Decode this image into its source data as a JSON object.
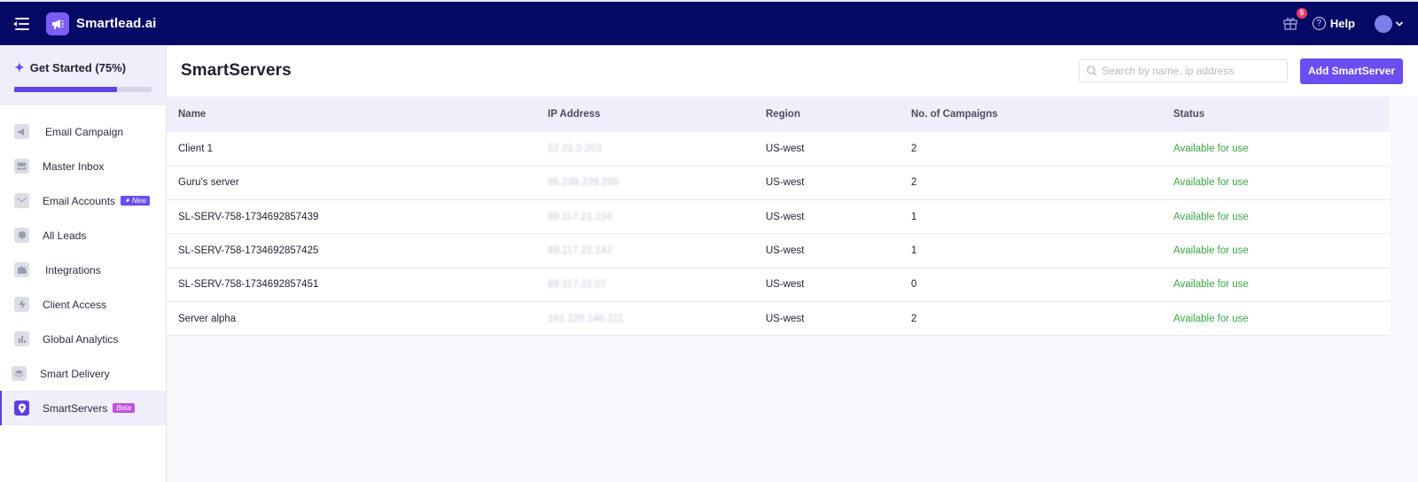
{
  "app": {
    "name": "Smartlead.ai"
  },
  "topbar": {
    "gift_badge": "5",
    "help_label": "Help"
  },
  "sidebar": {
    "get_started": {
      "label": "Get Started (75%)",
      "progress": 0.75
    },
    "items": [
      {
        "label": "Email Campaign",
        "icon": "megaphone-icon"
      },
      {
        "label": "Master Inbox",
        "icon": "inbox-icon"
      },
      {
        "label": "Email Accounts",
        "icon": "mail-icon",
        "tag": "✦ New"
      },
      {
        "label": "All Leads",
        "icon": "leads-icon"
      },
      {
        "label": "Integrations",
        "icon": "puzzle-icon"
      },
      {
        "label": "Client Access",
        "icon": "bolt-icon"
      },
      {
        "label": "Global Analytics",
        "icon": "chart-icon"
      },
      {
        "label": "Smart Delivery",
        "icon": "stack-icon"
      },
      {
        "label": "SmartServers",
        "icon": "location-icon",
        "tag": "Beta",
        "active": true
      }
    ]
  },
  "main": {
    "title": "SmartServers",
    "search_placeholder": "Search by name, ip address",
    "add_button": "Add SmartServer",
    "columns": [
      "Name",
      "IP Address",
      "Region",
      "No. of Campaigns",
      "Status"
    ],
    "rows": [
      {
        "name": "Client 1",
        "ip": "57.21.2.203",
        "region": "US-west",
        "campaigns": "2",
        "status": "Available for use"
      },
      {
        "name": "Guru's server",
        "ip": "85.239.239.200",
        "region": "US-west",
        "campaigns": "2",
        "status": "Available for use"
      },
      {
        "name": "SL-SERV-758-1734692857439",
        "ip": "89.117.21.154",
        "region": "US-west",
        "campaigns": "1",
        "status": "Available for use"
      },
      {
        "name": "SL-SERV-758-1734692857425",
        "ip": "89.117.22.142",
        "region": "US-west",
        "campaigns": "1",
        "status": "Available for use"
      },
      {
        "name": "SL-SERV-758-1734692857451",
        "ip": "89.117.22.07",
        "region": "US-west",
        "campaigns": "0",
        "status": "Available for use"
      },
      {
        "name": "Server alpha",
        "ip": "161.120.146.211",
        "region": "US-west",
        "campaigns": "2",
        "status": "Available for use"
      }
    ]
  }
}
